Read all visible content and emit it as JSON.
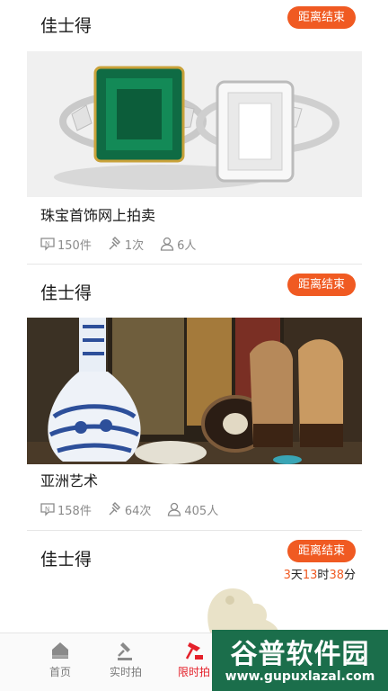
{
  "accent_color": "#f05a22",
  "lots": [
    {
      "house": "佳士得",
      "badge": "距离结束",
      "image_icon": "jewelry-image",
      "title": "珠宝首饰网上拍卖",
      "stats": {
        "items": "150件",
        "bids": "1次",
        "people": "6人"
      }
    },
    {
      "house": "佳士得",
      "badge": "距离结束",
      "image_icon": "asian-art-image",
      "title": "亚洲艺术",
      "stats": {
        "items": "158件",
        "bids": "64次",
        "people": "405人"
      }
    },
    {
      "house": "佳士得",
      "badge": "距离结束",
      "image_icon": "jade-figure-image",
      "countdown": {
        "days": "3",
        "days_unit": "天",
        "hours": "13",
        "hours_unit": "时",
        "minutes": "38",
        "minutes_unit": "分"
      }
    }
  ],
  "nav": {
    "items": [
      {
        "label": "首页",
        "icon": "home-icon"
      },
      {
        "label": "实时拍",
        "icon": "live-auction-icon"
      },
      {
        "label": "限时拍",
        "icon": "timed-auction-icon",
        "active": true
      }
    ]
  },
  "watermark": {
    "main": "谷普软件园",
    "url": "www.gupuxlazal.com"
  }
}
